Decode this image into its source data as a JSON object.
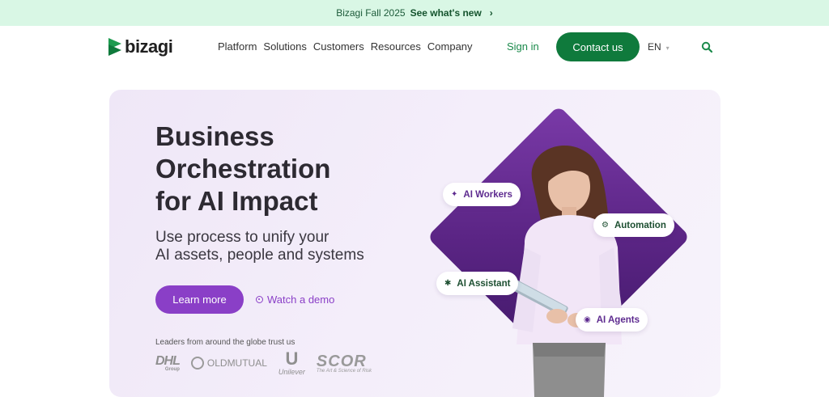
{
  "announcement": {
    "text": "Bizagi Fall 2025",
    "link": "See what's new",
    "chevron_icon": "chevron-right-icon"
  },
  "nav": {
    "logo_text": "bizagi",
    "items": [
      "Platform",
      "Solutions",
      "Customers",
      "Resources",
      "Company"
    ],
    "sign_in": "Sign in",
    "contact": "Contact us",
    "language": "EN",
    "search_icon": "search-icon"
  },
  "hero": {
    "title_lines": [
      "Business",
      "Orchestration",
      "for AI Impact"
    ],
    "subtitle_lines": [
      "Use process to unify your",
      "AI assets, people and systems"
    ],
    "learn_more": "Learn more",
    "watch_demo": "Watch a demo",
    "trust_text": "Leaders from around the globe trust us",
    "logos": {
      "dhl": "DHL",
      "dhl_group": "Group",
      "oldmutual": "OLDMUTUAL",
      "unilever": "Unilever",
      "scor": "SCOR",
      "scor_tagline": "The Art & Science of Risk"
    },
    "pills": {
      "ai_workers": "AI Workers",
      "automation": "Automation",
      "ai_assistant": "AI Assistant",
      "ai_agents": "AI Agents"
    }
  },
  "colors": {
    "brand_green": "#0f7a3c",
    "accent_purple": "#8a3fc7",
    "banner_bg": "#d9f7e5"
  }
}
